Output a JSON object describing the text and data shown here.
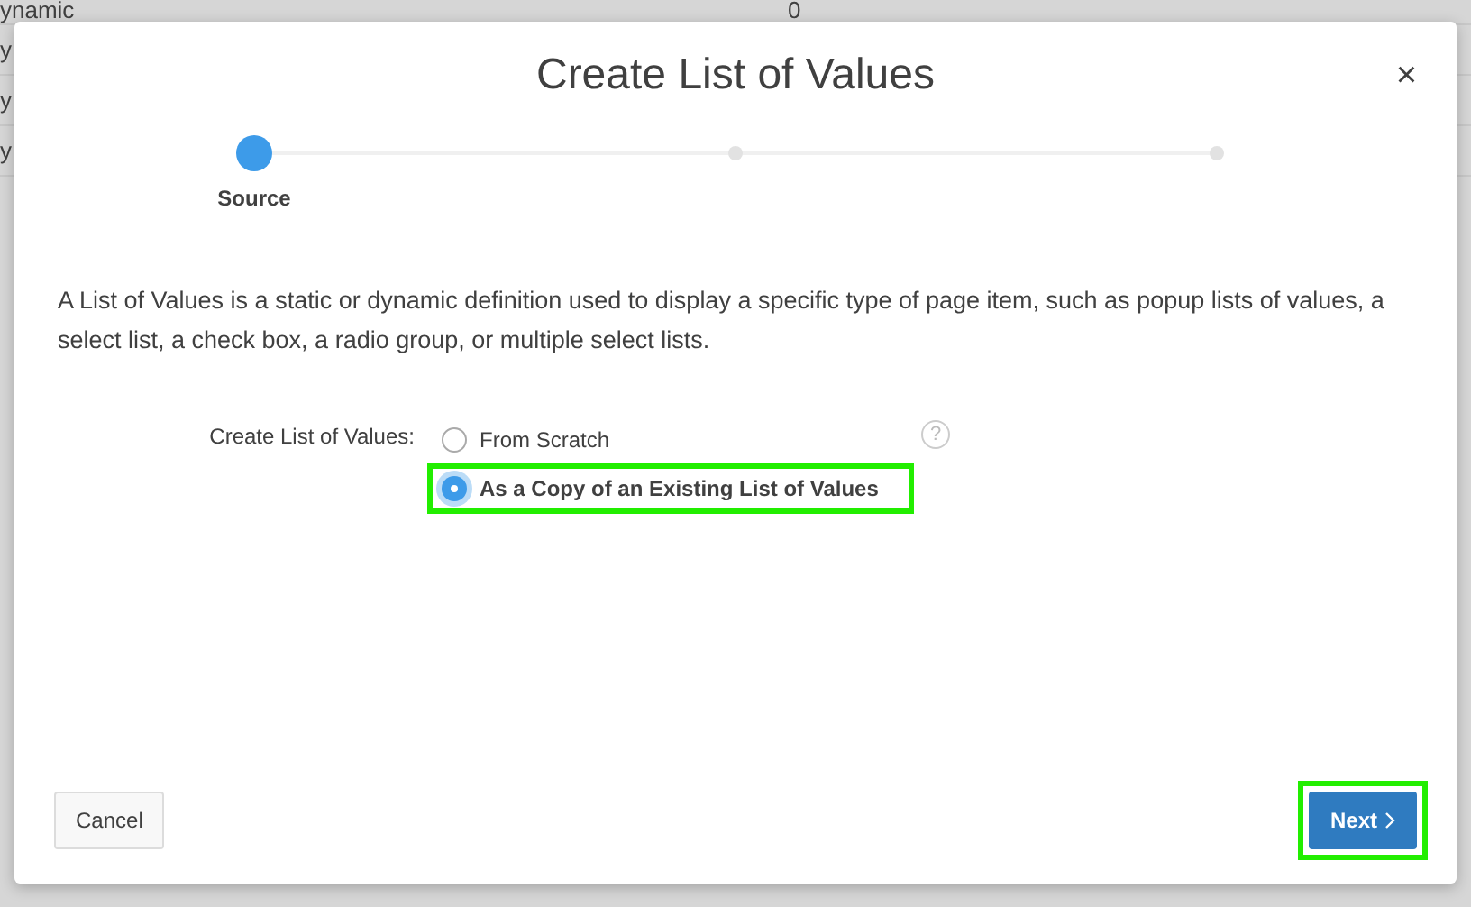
{
  "background_table": {
    "rows": [
      {
        "cells": [
          "ynamic",
          "0"
        ]
      },
      {
        "cells": [
          "y"
        ]
      },
      {
        "cells": [
          "y"
        ]
      },
      {
        "cells": [
          "y"
        ]
      }
    ]
  },
  "dialog": {
    "title": "Create List of Values",
    "close": "×",
    "steps": [
      {
        "label": "Source",
        "selected": true
      },
      {
        "selected": false
      },
      {
        "selected": false
      }
    ],
    "description": "A List of Values is a static or dynamic definition used to display a specific type of page item, such as popup lists of values, a select list, a check box, a radio group, or multiple select lists.",
    "field": {
      "label": "Create List of Values:",
      "help": "?",
      "options": [
        {
          "label": "From Scratch",
          "selected": false,
          "highlighted": false
        },
        {
          "label": "As a Copy of an Existing List of Values",
          "selected": true,
          "highlighted": true
        }
      ]
    },
    "buttons": [
      {
        "kind": "secondary",
        "label": "Cancel",
        "highlighted": false
      },
      {
        "kind": "primary",
        "label": "Next",
        "highlighted": true
      }
    ]
  }
}
